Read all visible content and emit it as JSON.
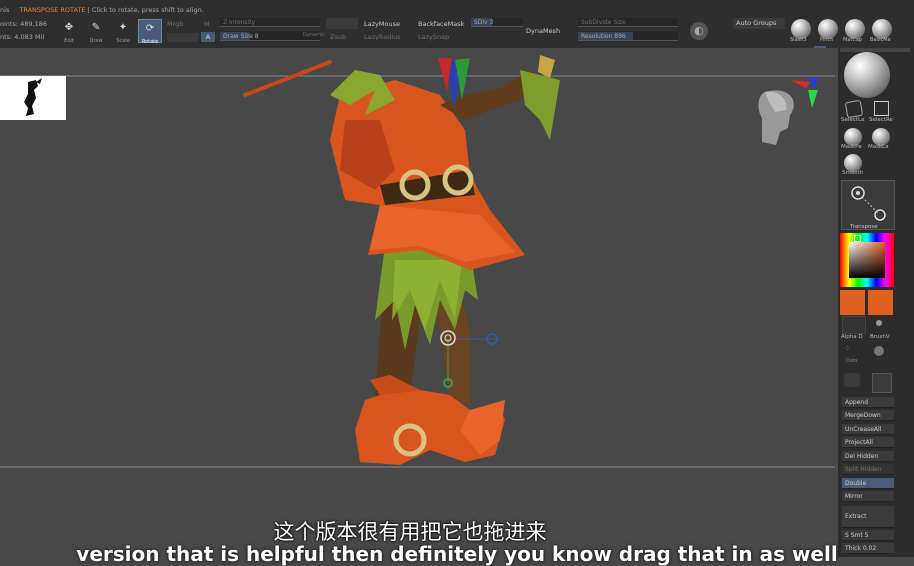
{
  "status": {
    "menu_fragment": "nis",
    "tool_mode": "TRANSPOSE ROTATE",
    "hint": "| Click to rotate, press shift to align.",
    "points": "oints: 489,186",
    "total_points": "nts: 4.083 Mil"
  },
  "toolbar": {
    "edit": "Edit",
    "draw": "Draw",
    "move": "Move",
    "scale": "Scale",
    "rotate": "Rotate",
    "mrgb": "Mrgb",
    "m": "M",
    "a": "A",
    "z_intensity": "Z Intensity",
    "draw_size": "Draw Size 8",
    "dynamic": "Dynamic",
    "zadd": "Zadd",
    "zsub": "Zsub",
    "lazy_mouse": "LazyMouse",
    "lazy_radius": "LazyRadius",
    "lazy_snap": "LazySnap",
    "backface_mask": "BackfaceMask",
    "sdiv": "SDiv 3",
    "dynamesh": "DynaMesh",
    "subdivide_size": "SubDivide Size",
    "resolution": "Resolution 896",
    "auto_groups": "Auto Groups",
    "brushes": [
      "Slash3",
      "Pinch",
      "MatCap",
      "BasicMa"
    ]
  },
  "tray": {
    "select_lasso": "SelectLa",
    "select_rect": "SelectRe",
    "mask_pen": "MaskPe",
    "mask_lasso": "MaskLa",
    "smooth": "Smooth",
    "transpose": "Transpose",
    "alpha": "Alpha D",
    "brush": "BrushV",
    "dots": "Dots",
    "append": "Append",
    "merge_down": "MergeDown",
    "uncrease_all": "UnCreaseAll",
    "project_all": "ProjectAll",
    "del_hidden": "Del Hidden",
    "split_hidden": "Split Hidden",
    "double": "Double",
    "mirror": "Mirror",
    "extract": "Extract",
    "s_smt": "S Smt 5",
    "thick": "Thick 0.02",
    "colors": {
      "primary": "#e06020",
      "secondary": "#e06020",
      "accent": "#4a5c78"
    }
  },
  "subtitles": {
    "chinese": "这个版本很有用把它也拖进来",
    "english": "version that is helpful then definitely you know drag that in as well"
  }
}
